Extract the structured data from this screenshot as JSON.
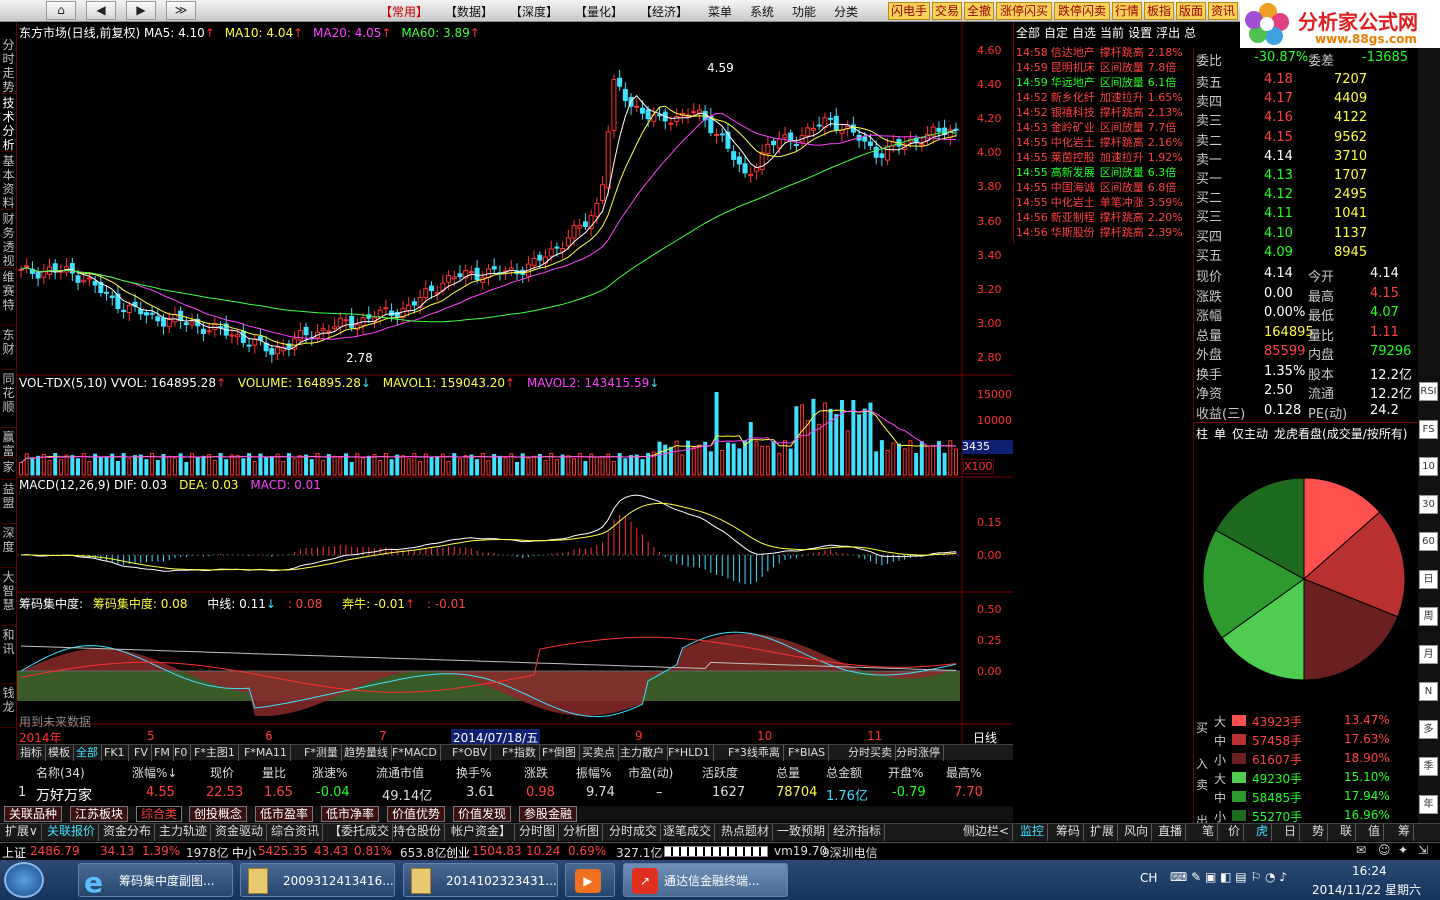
{
  "toolbar": {
    "nav": [
      "⌂",
      "◀",
      "▶",
      "≫"
    ],
    "menus": [
      "【常用】",
      "【数据】",
      "【深度】",
      "【量化】",
      "【经济】",
      "菜单",
      "系统",
      "功能",
      "分类"
    ],
    "buttons": [
      "闪电手",
      "交易",
      "全撤",
      "涨停闪买",
      "跌停闪卖",
      "行情",
      "板指",
      "版面",
      "资讯"
    ]
  },
  "logo": {
    "title": "分析家公式网",
    "site": "www.88gs.com"
  },
  "left_tabs": [
    "分时走势",
    "技术分析",
    "基本资料",
    "财务透视",
    "维赛特",
    "东财",
    "同花顺",
    "赢富",
    "家",
    "益盟",
    "深度",
    "大智慧",
    "和讯",
    "钱龙"
  ],
  "chart": {
    "kline_title": {
      "name": "东方市场(日线,前复权)",
      "ma5": "MA5: 4.10",
      "ma10": "MA10: 4.04",
      "ma20": "MA20: 4.05",
      "ma60": "MA60: 3.89"
    },
    "price_axis": [
      "4.60",
      "4.40",
      "4.20",
      "4.00",
      "3.80",
      "3.60",
      "3.40",
      "3.20",
      "3.00",
      "2.80"
    ],
    "hi_label": "4.59",
    "lo_label": "2.78",
    "vol_title": {
      "name": "VOL-TDX(5,10)",
      "vvol": "VVOL: 164895.28",
      "volume": "VOLUME: 164895.28",
      "mavol1": "MAVOL1: 159043.20",
      "mavol2": "MAVOL2: 143415.59"
    },
    "vol_axis": [
      "15000",
      "10000",
      "5000"
    ],
    "vol_current": "3435",
    "vol_unit": "X100",
    "macd_title": {
      "name": "MACD(12,26,9)",
      "dif": "DIF: 0.03",
      "dea": "DEA: 0.03",
      "macd": "MACD: 0.01"
    },
    "macd_axis": [
      "0.15",
      "0.00"
    ],
    "chip_title": {
      "name": "筹码集中度:",
      "v1": "筹码集中度: 0.08",
      "v2": "中线: 0.11",
      "v3": ": 0.08",
      "v4": "奔牛: -0.01",
      "v5": ": -0.01"
    },
    "chip_axis": [
      "0.50",
      "0.25",
      "0.00"
    ],
    "future_note": "用到未来数据",
    "months": [
      "2014年",
      "5",
      "6",
      "7",
      "8",
      "9",
      "10",
      "11"
    ],
    "date_box": "2014/07/18/五",
    "period": "日线"
  },
  "chart_data": {
    "type": "candlestick",
    "title": "东方市场(日线,前复权)",
    "ylim": [
      2.72,
      4.72
    ],
    "ma": {
      "MA5": 4.1,
      "MA10": 4.04,
      "MA20": 4.05,
      "MA60": 3.89
    },
    "high": 4.59,
    "low": 2.78,
    "volume": 164895.28,
    "mavol1": 159043.2,
    "mavol2": 143415.59,
    "dif": 0.03,
    "dea": 0.03,
    "macd": 0.01
  },
  "monitor": {
    "tabs": [
      "全部",
      "自定",
      "自选",
      "当前",
      "设置",
      "浮出",
      "总"
    ],
    "rows": [
      {
        "t": "14:58",
        "n": "信达地产",
        "e": "撑杆跳高",
        "v": "2.18%",
        "c": "r"
      },
      {
        "t": "14:59",
        "n": "昆明机床",
        "e": "区间放量",
        "v": "7.8倍",
        "c": "r"
      },
      {
        "t": "14:59",
        "n": "华远地产",
        "e": "区间放量",
        "v": "6.1倍",
        "c": "g"
      },
      {
        "t": "14:52",
        "n": "新乡化纤",
        "e": "加速拉升",
        "v": "1.65%",
        "c": "r"
      },
      {
        "t": "14:52",
        "n": "银禧科技",
        "e": "撑杆跳高",
        "v": "2.13%",
        "c": "r"
      },
      {
        "t": "14:53",
        "n": "金岭矿业",
        "e": "区间放量",
        "v": "7.7倍",
        "c": "r"
      },
      {
        "t": "14:55",
        "n": "中化岩土",
        "e": "撑杆跳高",
        "v": "2.16%",
        "c": "r"
      },
      {
        "t": "14:55",
        "n": "莱茵控股",
        "e": "加速拉升",
        "v": "1.92%",
        "c": "r"
      },
      {
        "t": "14:55",
        "n": "高新发展",
        "e": "区间放量",
        "v": "6.3倍",
        "c": "g"
      },
      {
        "t": "14:55",
        "n": "中国海诚",
        "e": "区间放量",
        "v": "6.8倍",
        "c": "r"
      },
      {
        "t": "14:55",
        "n": "中化岩土",
        "e": "单笔冲涨",
        "v": "3.59%",
        "c": "r"
      },
      {
        "t": "14:56",
        "n": "新亚制程",
        "e": "撑杆跳高",
        "v": "2.20%",
        "c": "r"
      },
      {
        "t": "14:56",
        "n": "华斯股份",
        "e": "撑杆跳高",
        "v": "2.39%",
        "c": "r"
      }
    ]
  },
  "quote": {
    "weibi": {
      "l": "委比",
      "v": "-30.87%",
      "l2": "委差",
      "v2": "-13685"
    },
    "asks": [
      {
        "l": "卖五",
        "p": "4.18",
        "q": "7207"
      },
      {
        "l": "卖四",
        "p": "4.17",
        "q": "4409"
      },
      {
        "l": "卖三",
        "p": "4.16",
        "q": "4122"
      },
      {
        "l": "卖二",
        "p": "4.15",
        "q": "9562"
      },
      {
        "l": "卖一",
        "p": "4.14",
        "q": "3710"
      }
    ],
    "bids": [
      {
        "l": "买一",
        "p": "4.13",
        "q": "1707"
      },
      {
        "l": "买二",
        "p": "4.12",
        "q": "2495"
      },
      {
        "l": "买三",
        "p": "4.11",
        "q": "1041"
      },
      {
        "l": "买四",
        "p": "4.10",
        "q": "1137"
      },
      {
        "l": "买五",
        "p": "4.09",
        "q": "8945"
      }
    ],
    "stats": [
      {
        "l": "现价",
        "v": "4.14",
        "vc": "wht",
        "l2": "今开",
        "v2": "4.14",
        "v2c": "wht"
      },
      {
        "l": "涨跌",
        "v": "0.00",
        "vc": "wht",
        "l2": "最高",
        "v2": "4.15",
        "v2c": "red"
      },
      {
        "l": "涨幅",
        "v": "0.00%",
        "vc": "wht",
        "l2": "最低",
        "v2": "4.07",
        "v2c": "grn"
      },
      {
        "l": "总量",
        "v": "164895",
        "vc": "yel",
        "l2": "量比",
        "v2": "1.11",
        "v2c": "red"
      },
      {
        "l": "外盘",
        "v": "85599",
        "vc": "red",
        "l2": "内盘",
        "v2": "79296",
        "v2c": "grn"
      },
      {
        "l": "换手",
        "v": "1.35%",
        "vc": "wht",
        "l2": "股本",
        "v2": "12.2亿",
        "v2c": "wht"
      },
      {
        "l": "净资",
        "v": "2.50",
        "vc": "wht",
        "l2": "流通",
        "v2": "12.2亿",
        "v2c": "wht"
      },
      {
        "l": "收益(三)",
        "v": "0.128",
        "vc": "wht",
        "l2": "PE(动)",
        "v2": "24.2",
        "v2c": "wht"
      }
    ]
  },
  "pie_panel": {
    "tabs": [
      "柱",
      "单",
      "仅主动",
      "龙虎看盘(成交量/按所有)"
    ],
    "slices": [
      {
        "label": "买大",
        "v": "43923手",
        "pct": 13.47,
        "color": "#ff5050"
      },
      {
        "label": "买中",
        "v": "57458手",
        "pct": 17.63,
        "color": "#b83030"
      },
      {
        "label": "买小",
        "v": "61607手",
        "pct": 18.9,
        "color": "#6a2020"
      },
      {
        "label": "卖大",
        "v": "49230手",
        "pct": 15.1,
        "color": "#50cc50"
      },
      {
        "label": "卖中",
        "v": "58485手",
        "pct": 17.94,
        "color": "#2e9a2e"
      },
      {
        "label": "卖小",
        "v": "55270手",
        "pct": 16.96,
        "color": "#1e6a1e"
      }
    ],
    "pct_labels": [
      "13.47%",
      "17.63%",
      "18.90%",
      "15.10%",
      "17.94%",
      "16.96%"
    ],
    "side": [
      "买",
      "入",
      "卖",
      "出"
    ],
    "size": [
      "大",
      "中",
      "小",
      "大",
      "中",
      "小"
    ]
  },
  "right_tabs": [
    "监控",
    "筹码",
    "扩展",
    "风向",
    "直播",
    "笔",
    "价",
    "虎",
    "日",
    "势",
    "联",
    "值",
    "筹"
  ],
  "mid_tabs": [
    "指标",
    "模板",
    "全部",
    "FK1",
    "FV",
    "FM",
    "F0",
    "F*主图1",
    "F*MA11",
    "F*测量",
    "趋势量线",
    "F*MACD",
    "F*OBV",
    "F*指数",
    "F*倒图",
    "买卖点",
    "主力散户",
    "F*HLD1",
    "F*3线乖离",
    "F*BIAS",
    "分时买卖",
    "分时涨停"
  ],
  "list": {
    "headers": [
      "名称(34)",
      "涨幅%↓",
      "现价",
      "量比",
      "涨速%",
      "流通市值",
      "换手%",
      "涨跌",
      "振幅%",
      "市盈(动)",
      "活跃度",
      "总量",
      "总金额",
      "开盘%",
      "最高%"
    ],
    "row": [
      "1",
      "万好万家",
      "4.55",
      "22.53",
      "1.65",
      "-0.04",
      "49.14亿",
      "3.61",
      "0.98",
      "9.74",
      "–",
      "1627",
      "78704",
      "1.76亿",
      "-0.79",
      "7.70"
    ]
  },
  "sector_tabs": [
    "关联品种",
    "江苏板块",
    "综合类",
    "创投概念",
    "低市盈率",
    "低市净率",
    "价值优势",
    "价值发现",
    "参股金融"
  ],
  "bottom_tabs": [
    "扩展∨",
    "关联报价",
    "资金分布",
    "主力轨迹",
    "资金驱动",
    "综合资讯",
    "【委托成交",
    "持仓股份",
    "帐户资金】",
    "分时图",
    "分析图",
    "分时成交",
    "逐笔成交",
    "热点题材",
    "一致预期",
    "经济指标",
    "侧边栏<"
  ],
  "statusbar": {
    "sh_label": "上证",
    "sh": "2486.79",
    "sh_ch": "34.13",
    "sh_pct": "1.39%",
    "sh_amt": "1978亿",
    "zx_label": "中小",
    "zx": "5425.35",
    "zx_ch": "43.43",
    "zx_pct": "0.81%",
    "zx_amt": "653.8亿",
    "cy_label": "创业",
    "cy": "1504.83",
    "cy_ch": "10.24",
    "cy_pct": "0.69%",
    "cy_amt": "327.1亿",
    "ver": "vm19.70",
    "server": "9深圳电信"
  },
  "taskbar": {
    "items": [
      "筹码集中度副图...",
      "2009312413416...",
      "2014102323431...",
      "",
      "通达信金融终端..."
    ],
    "lang": "CH",
    "time": "16:24",
    "date": "2014/11/22 星期六"
  },
  "side_icons": [
    "RSI",
    "FS",
    "10",
    "30",
    "60",
    "日",
    "周",
    "月",
    "N",
    "多",
    "季",
    "年"
  ]
}
